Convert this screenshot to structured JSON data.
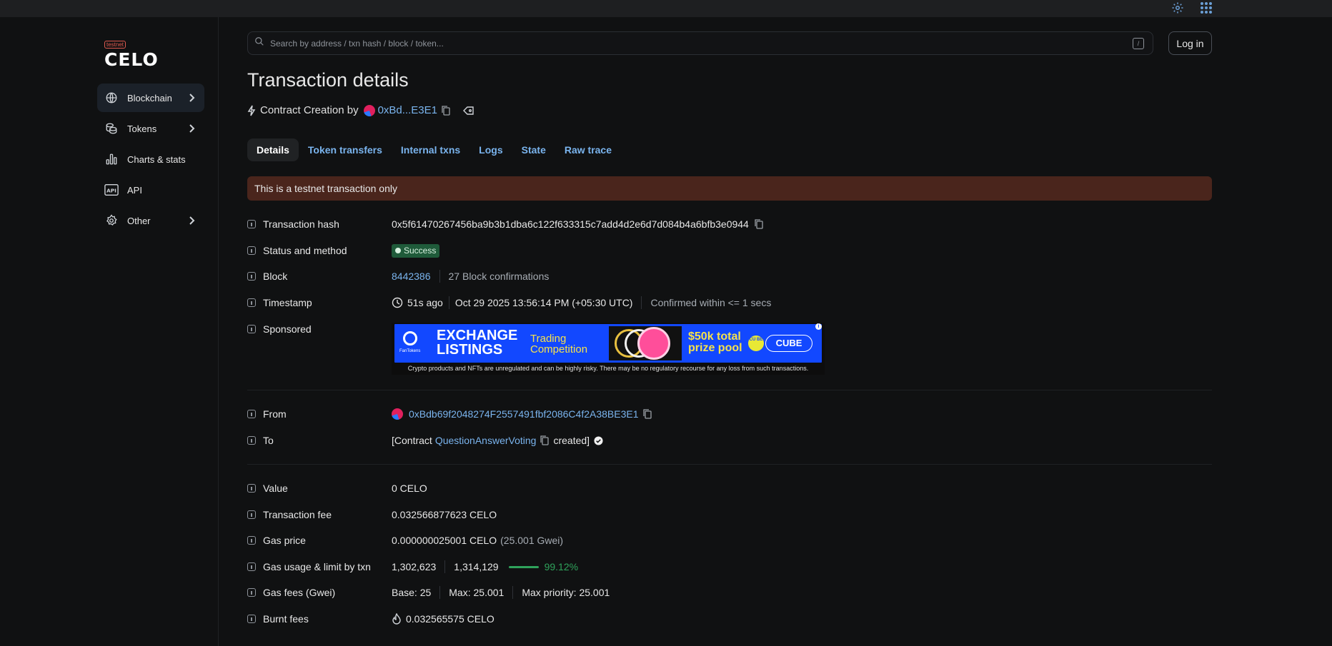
{
  "topbar": {
    "settings_icon": "gear-icon",
    "apps_icon": "grid-icon"
  },
  "logo": {
    "badge": "testnet",
    "word": "CELO"
  },
  "sidebar": {
    "items": [
      {
        "label": "Blockchain",
        "icon": "globe-icon",
        "has_chevron": true,
        "active": true
      },
      {
        "label": "Tokens",
        "icon": "coins-icon",
        "has_chevron": true,
        "active": false
      },
      {
        "label": "Charts & stats",
        "icon": "chart-icon",
        "has_chevron": false,
        "active": false
      },
      {
        "label": "API",
        "icon": "api-icon",
        "has_chevron": false,
        "active": false
      },
      {
        "label": "Other",
        "icon": "gear-icon",
        "has_chevron": true,
        "active": false
      }
    ]
  },
  "search": {
    "placeholder": "Search by address / txn hash / block / token...",
    "shortcut": "/"
  },
  "header": {
    "login_label": "Log in",
    "title": "Transaction details"
  },
  "subtitle": {
    "prefix": "Contract Creation by",
    "address": "0xBd...E3E1"
  },
  "tabs": [
    "Details",
    "Token transfers",
    "Internal txns",
    "Logs",
    "State",
    "Raw trace"
  ],
  "alert": "This is a testnet transaction only",
  "details": {
    "tx_hash": {
      "label": "Transaction hash",
      "value": "0x5f61470267456ba9b3b1dba6c122f633315c7add4d2e6d7d084b4a6bfb3e0944"
    },
    "status": {
      "label": "Status and method",
      "value": "Success"
    },
    "block": {
      "label": "Block",
      "number": "8442386",
      "confirmations": "27 Block confirmations"
    },
    "timestamp": {
      "label": "Timestamp",
      "ago": "51s ago",
      "date": "Oct 29 2025 13:56:14 PM (+05:30 UTC)",
      "confirmed": "Confirmed within <= 1 secs"
    },
    "sponsored": {
      "label": "Sponsored"
    },
    "from": {
      "label": "From",
      "address": "0xBdb69f2048274F2557491fbf2086C4f2A38BE3E1"
    },
    "to": {
      "label": "To",
      "prefix": "[Contract",
      "contract": "QuestionAnswerVoting",
      "suffix": "created]"
    },
    "value": {
      "label": "Value",
      "value": "0 CELO"
    },
    "fee": {
      "label": "Transaction fee",
      "value": "0.032566877623 CELO"
    },
    "gas_price": {
      "label": "Gas price",
      "value": "0.000000025001 CELO",
      "gwei": "(25.001 Gwei)"
    },
    "gas_usage": {
      "label": "Gas usage & limit by txn",
      "used": "1,302,623",
      "limit": "1,314,129",
      "percent": "99.12%"
    },
    "gas_fees": {
      "label": "Gas fees (Gwei)",
      "base": "Base: 25",
      "max": "Max: 25.001",
      "priority": "Max priority: 25.001"
    },
    "burnt": {
      "label": "Burnt fees",
      "value": "0.032565575 CELO"
    }
  },
  "ad": {
    "brand": "FanTokens",
    "headline1": "EXCHANGE",
    "headline2": "LISTINGS",
    "sub1": "Trading",
    "sub2": "Competition",
    "prize1": "$50k total",
    "prize2": "prize pool",
    "cube_badge": "CU BE",
    "cube_button": "CUBE",
    "disclaimer": "Crypto products and NFTs are unregulated and can be highly risky. There may be no regulatory recourse for any loss from such transactions."
  },
  "colors": {
    "accent": "#7ab4ee",
    "success": "#1f5b3a",
    "alert_bg": "#4a251c",
    "gas_green": "#2fa35b",
    "ad_blue": "#1248ff"
  }
}
